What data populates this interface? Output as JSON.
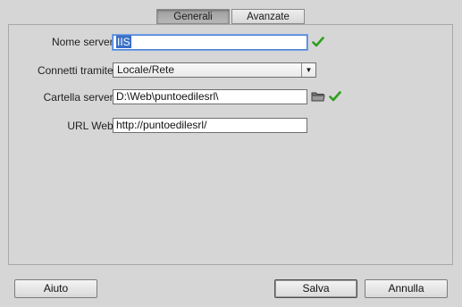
{
  "tabs": [
    {
      "label": "Generali",
      "active": true
    },
    {
      "label": "Avanzate",
      "active": false
    }
  ],
  "form": {
    "server_name": {
      "label": "Nome server:",
      "value": "IIS",
      "valid": true
    },
    "connect_via": {
      "label": "Connetti tramite:",
      "value": "Locale/Rete"
    },
    "server_folder": {
      "label": "Cartella server:",
      "value": "D:\\Web\\puntoedilesrl\\",
      "valid": true
    },
    "web_url": {
      "label": "URL Web:",
      "value": "http://puntoedilesrl/"
    }
  },
  "buttons": {
    "help": "Aiuto",
    "save": "Salva",
    "cancel": "Annulla"
  },
  "colors": {
    "check": "#2f9e1e",
    "selection": "#3a6fc9"
  },
  "icons": {
    "valid": "check-icon",
    "browse": "folder-icon",
    "dropdown": "chevron-down-icon"
  }
}
